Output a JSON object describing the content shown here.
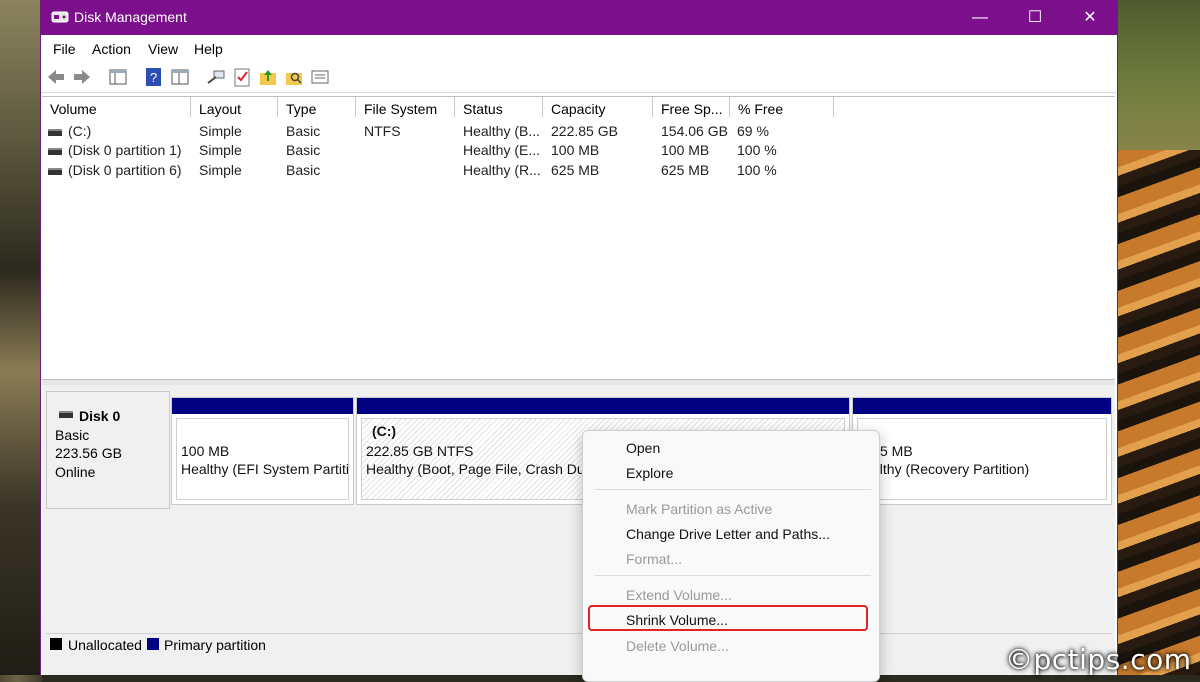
{
  "window": {
    "title": "Disk Management",
    "controls": {
      "minimize": "—",
      "maximize": "☐",
      "close": "✕"
    }
  },
  "menu": [
    "File",
    "Action",
    "View",
    "Help"
  ],
  "toolbar_icons": [
    "back-arrow-icon",
    "forward-arrow-icon",
    "console-tree-icon",
    "help-icon",
    "properties-icon",
    "connect-icon",
    "checklist-icon",
    "up-arrow-folder-icon",
    "search-folder-icon",
    "list-view-icon"
  ],
  "volume_table": {
    "columns": [
      "Volume",
      "Layout",
      "Type",
      "File System",
      "Status",
      "Capacity",
      "Free Sp...",
      "% Free"
    ],
    "rows": [
      [
        "(C:)",
        "Simple",
        "Basic",
        "NTFS",
        "Healthy (B...",
        "222.85 GB",
        "154.06 GB",
        "69 %"
      ],
      [
        "(Disk 0 partition 1)",
        "Simple",
        "Basic",
        "",
        "Healthy (E...",
        "100 MB",
        "100 MB",
        "100 %"
      ],
      [
        "(Disk 0 partition 6)",
        "Simple",
        "Basic",
        "",
        "Healthy (R...",
        "625 MB",
        "625 MB",
        "100 %"
      ]
    ]
  },
  "disk": {
    "name": "Disk 0",
    "type": "Basic",
    "size": "223.56 GB",
    "state": "Online",
    "partitions": [
      {
        "title": "",
        "line1": "100 MB",
        "line2": "Healthy (EFI System Partitio"
      },
      {
        "title": "(C:)",
        "line1": "222.85 GB NTFS",
        "line2": "Healthy (Boot, Page File, Crash Dum"
      },
      {
        "title": "",
        "line1": "5 MB",
        "line2": "althy (Recovery Partition)"
      }
    ]
  },
  "legend": {
    "unallocated": "Unallocated",
    "primary": "Primary partition",
    "unallocated_color": "#000000",
    "primary_color": "#000080"
  },
  "context_menu": {
    "open": "Open",
    "explore": "Explore",
    "mark_active": "Mark Partition as Active",
    "change_letter": "Change Drive Letter and Paths...",
    "format": "Format...",
    "extend": "Extend Volume...",
    "shrink": "Shrink Volume...",
    "delete": "Delete Volume..."
  },
  "watermark": "©pctips.com",
  "colors": {
    "titlebar": "#7b0f8c",
    "partition_bar": "#000080",
    "highlight": "#e02424"
  }
}
